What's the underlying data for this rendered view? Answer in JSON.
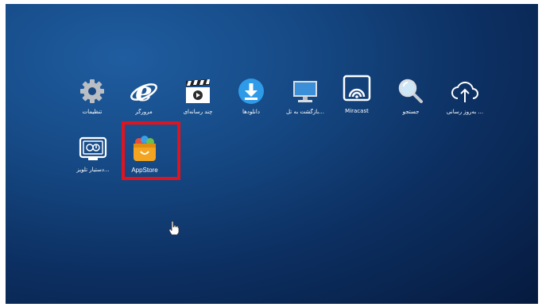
{
  "apps_row1": [
    {
      "label": "تنظیمات",
      "icon": "gear-icon"
    },
    {
      "label": "مرورگر",
      "icon": "browser-icon"
    },
    {
      "label": "چند رسانه‌ای",
      "icon": "clapperboard-icon"
    },
    {
      "label": "دانلودها",
      "icon": "download-icon"
    },
    {
      "label": "بازگشت به تل...",
      "icon": "monitor-icon"
    },
    {
      "label": "Miracast",
      "icon": "cast-icon"
    },
    {
      "label": "جستجو",
      "icon": "search-icon"
    },
    {
      "label": "به‌روز رسانی ...",
      "icon": "cloud-upload-icon"
    }
  ],
  "apps_row2": [
    {
      "label": "دستیار تلویز...",
      "icon": "tv-assistant-icon"
    },
    {
      "label": "AppStore",
      "icon": "appstore-bag-icon"
    }
  ],
  "colors": {
    "highlight": "#e0141e",
    "background_top": "#1f5da0",
    "background_bottom": "#061a3e"
  }
}
